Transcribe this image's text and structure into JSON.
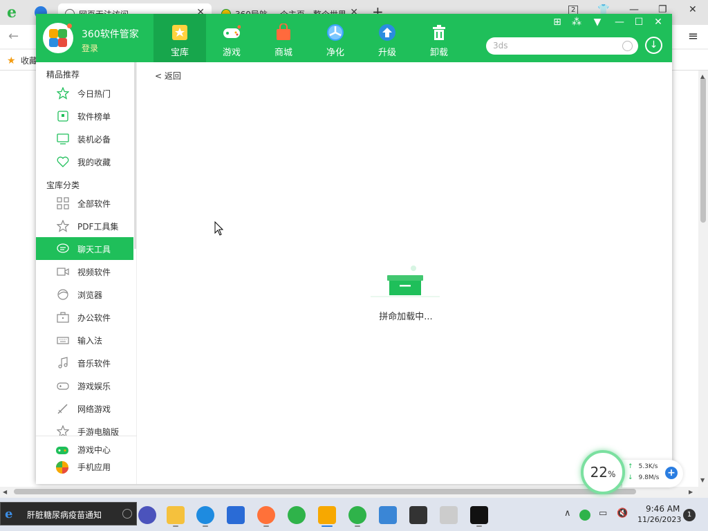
{
  "browser": {
    "tabs": [
      {
        "title": "网页无法访问"
      },
      {
        "title": "360导航_一个主页，整个世界"
      }
    ],
    "new_tab_label": "+",
    "tab_count": "2",
    "favorites_label": "收藏"
  },
  "app": {
    "name": "360软件管家",
    "login_label": "登录",
    "nav": [
      {
        "label": "宝库",
        "icon": "treasure-icon",
        "active": true
      },
      {
        "label": "游戏",
        "icon": "gamepad-icon"
      },
      {
        "label": "商城",
        "icon": "shopping-bag-icon"
      },
      {
        "label": "净化",
        "icon": "fan-icon"
      },
      {
        "label": "升级",
        "icon": "upgrade-arrow-icon"
      },
      {
        "label": "卸载",
        "icon": "trash-icon"
      }
    ],
    "search_value": "3ds",
    "accent_color": "#1fbf5a"
  },
  "sidebar": {
    "section1_title": "精品推荐",
    "section1_items": [
      {
        "label": "今日热门",
        "icon": "star-outline-icon"
      },
      {
        "label": "软件榜单",
        "icon": "ranking-icon"
      },
      {
        "label": "装机必备",
        "icon": "monitor-icon"
      },
      {
        "label": "我的收藏",
        "icon": "heart-icon"
      }
    ],
    "section2_title": "宝库分类",
    "section2_items": [
      {
        "label": "全部软件",
        "icon": "grid-icon"
      },
      {
        "label": "PDF工具集",
        "icon": "star-icon"
      },
      {
        "label": "聊天工具",
        "icon": "chat-icon",
        "active": true
      },
      {
        "label": "视频软件",
        "icon": "video-camera-icon"
      },
      {
        "label": "浏览器",
        "icon": "browser-icon"
      },
      {
        "label": "办公软件",
        "icon": "briefcase-icon"
      },
      {
        "label": "输入法",
        "icon": "keyboard-icon"
      },
      {
        "label": "音乐软件",
        "icon": "music-note-icon"
      },
      {
        "label": "游戏娱乐",
        "icon": "gamepad-small-icon"
      },
      {
        "label": "网络游戏",
        "icon": "sword-icon"
      },
      {
        "label": "手游电脑版",
        "icon": "star-small-icon"
      }
    ],
    "bottom_items": [
      {
        "label": "游戏中心",
        "icon": "game-center-icon"
      },
      {
        "label": "手机应用",
        "icon": "mobile-app-icon"
      }
    ]
  },
  "content": {
    "back_label": "< 返回",
    "loading_text": "拼命加载中..."
  },
  "speed_widget": {
    "percent": "22",
    "percent_unit": "%",
    "upload": "5.3K/s",
    "download": "9.8M/s"
  },
  "taskbar": {
    "news_text": "肝脏糖尿病疫苗通知",
    "time": "9:46 AM",
    "date": "11/26/2023",
    "notification_count": "1"
  }
}
